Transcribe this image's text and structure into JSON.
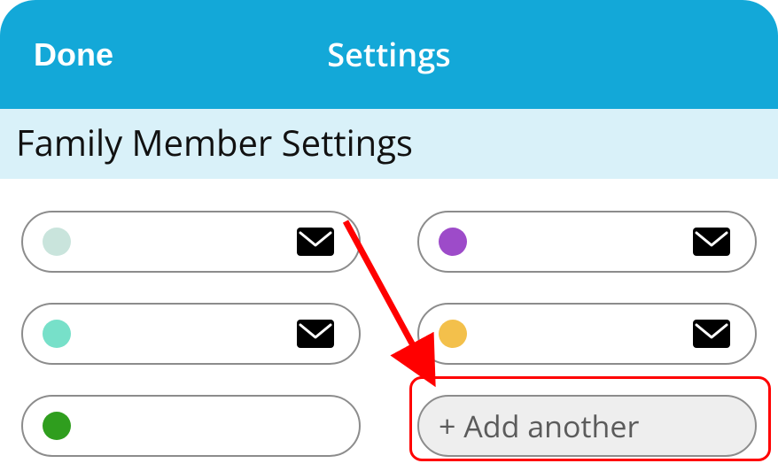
{
  "header": {
    "done_label": "Done",
    "title": "Settings"
  },
  "section": {
    "title": "Family Member Settings"
  },
  "members": [
    {
      "color": "#c9e4dc",
      "name": "",
      "has_mail": true
    },
    {
      "color": "#9d4bc9",
      "name": "",
      "has_mail": true
    },
    {
      "color": "#77e0c9",
      "name": "",
      "has_mail": true
    },
    {
      "color": "#f3c04b",
      "name": "",
      "has_mail": true
    },
    {
      "color": "#2f9e1e",
      "name": "",
      "has_mail": false
    }
  ],
  "add_button": {
    "label": "+ Add another"
  },
  "annotation": {
    "highlight_target": "add-another-button",
    "arrow_color": "#ff0000"
  }
}
